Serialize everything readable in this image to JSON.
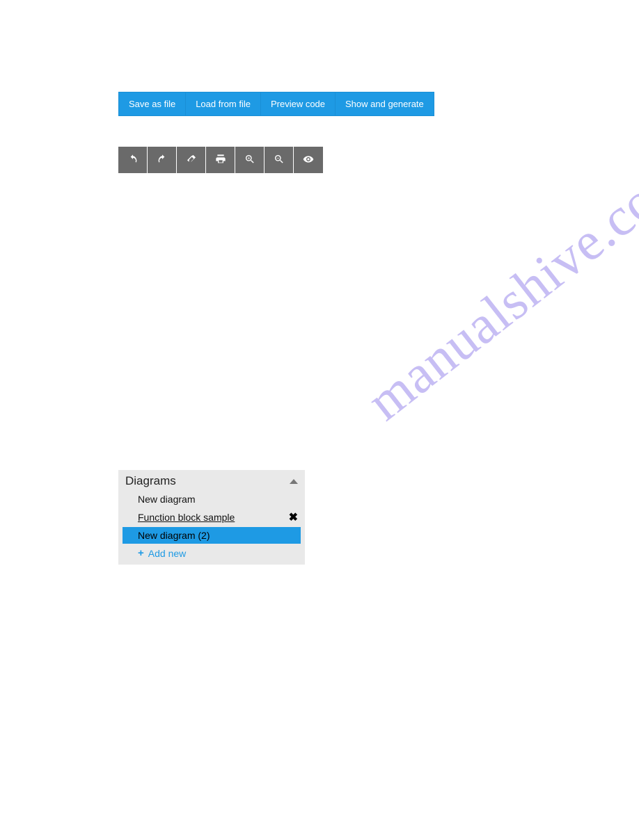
{
  "toolbar": {
    "save_as_file": "Save as file",
    "load_from_file": "Load from file",
    "preview_code": "Preview code",
    "show_and_generate": "Show and generate"
  },
  "icon_toolbar": {
    "undo": "undo-icon",
    "redo": "redo-icon",
    "eraser": "eraser-icon",
    "print": "print-icon",
    "zoom_in": "zoom-in-icon",
    "zoom_out": "zoom-out-icon",
    "eye": "eye-icon"
  },
  "diagrams": {
    "title": "Diagrams",
    "items": [
      {
        "label": "New diagram",
        "selected": false,
        "closable": false
      },
      {
        "label": "Function block sample",
        "selected": false,
        "closable": true,
        "underline": true
      },
      {
        "label": "New diagram (2)",
        "selected": true,
        "closable": false
      }
    ],
    "add_new": "Add new"
  },
  "watermark": "manualshive.com"
}
